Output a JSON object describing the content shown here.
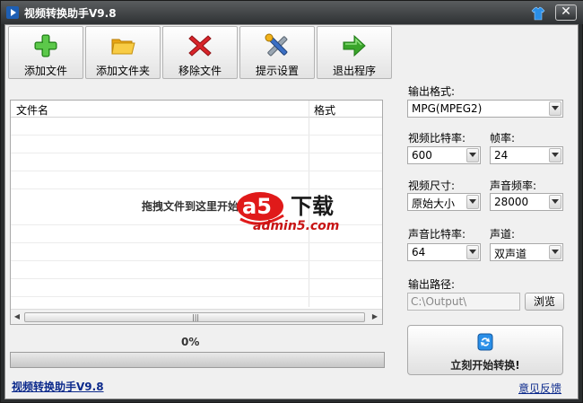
{
  "window": {
    "title": "视频转换助手V9.8",
    "close_glyph": "✕"
  },
  "toolbar": [
    {
      "key": "add-file",
      "label": "添加文件",
      "icon": "plus-icon",
      "color": "#3aa52a"
    },
    {
      "key": "add-folder",
      "label": "添加文件夹",
      "icon": "folder-icon",
      "color": "#f2b21b"
    },
    {
      "key": "remove-file",
      "label": "移除文件",
      "icon": "remove-x-icon",
      "color": "#d8242a"
    },
    {
      "key": "settings",
      "label": "提示设置",
      "icon": "tools-icon",
      "color": "#3b6fc4"
    },
    {
      "key": "exit",
      "label": "退出程序",
      "icon": "arrow-right-icon",
      "color": "#3aa52a"
    }
  ],
  "filelist": {
    "col_name": "文件名",
    "col_format": "格式",
    "empty_hint": "拖拽文件到这里开始",
    "scroll_grip": "|||"
  },
  "progress": {
    "percent_text": "0%",
    "value": 0,
    "fill_color": "#3c8ee0"
  },
  "footer": {
    "app_link": "视频转换助手V9.8",
    "feedback": "意见反馈"
  },
  "settings": {
    "output_format": {
      "label": "输出格式:",
      "value": "MPG(MPEG2)"
    },
    "video_bitrate": {
      "label": "视频比特率:",
      "value": "600"
    },
    "frame_rate": {
      "label": "帧率:",
      "value": "24"
    },
    "video_size": {
      "label": "视频尺寸:",
      "value": "原始大小"
    },
    "audio_rate": {
      "label": "声音频率:",
      "value": "28000"
    },
    "audio_bitrate": {
      "label": "声音比特率:",
      "value": "64"
    },
    "channels": {
      "label": "声道:",
      "value": "双声道"
    },
    "output_path": {
      "label": "输出路径:",
      "value": "C:\\Output\\"
    },
    "browse_label": "浏览"
  },
  "start_button": {
    "label": "立刻开始转换!",
    "icon": "convert-refresh-icon"
  },
  "watermark": {
    "text_a5": "a5",
    "text_xiazai": "下载",
    "site": "admin5.com"
  }
}
